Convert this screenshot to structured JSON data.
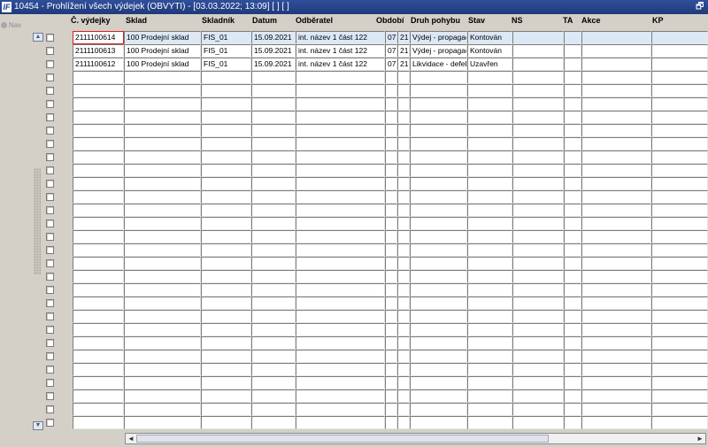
{
  "window": {
    "logo": "IF",
    "title": "10454 - Prohlížení všech výdejek (OBVYTI) - [03.03.2022; 13:09]  [ ]  [ ]",
    "restore_glyph": "🗗"
  },
  "nav": {
    "label": "Nav"
  },
  "columns": [
    "Č. výdejky",
    "Sklad",
    "Skladník",
    "Datum",
    "Odběratel",
    "Období",
    "Druh pohybu",
    "Stav",
    "NS",
    "TA",
    "Akce",
    "KP"
  ],
  "rows": [
    [
      "2111100614",
      "100 Prodejní sklad",
      "FIS_01",
      "15.09.2021",
      "int. název 1 část 122",
      "07",
      "21",
      "Výdej - propagace",
      "Kontován",
      "",
      "",
      "",
      ""
    ],
    [
      "2111100613",
      "100 Prodejní sklad",
      "FIS_01",
      "15.09.2021",
      "int. název 1 část 122",
      "07",
      "21",
      "Výdej - propagace",
      "Kontován",
      "",
      "",
      "",
      ""
    ],
    [
      "2111100612",
      "100 Prodejní sklad",
      "FIS_01",
      "15.09.2021",
      "int. název 1 část 122",
      "07",
      "21",
      "Likvidace - defekt",
      "Uzavřen",
      "",
      "",
      "",
      ""
    ]
  ],
  "empty_row_count": 27,
  "active_row": 0,
  "scroll": {
    "up": "▲",
    "down": "▼",
    "left": "◄",
    "right": "►"
  }
}
